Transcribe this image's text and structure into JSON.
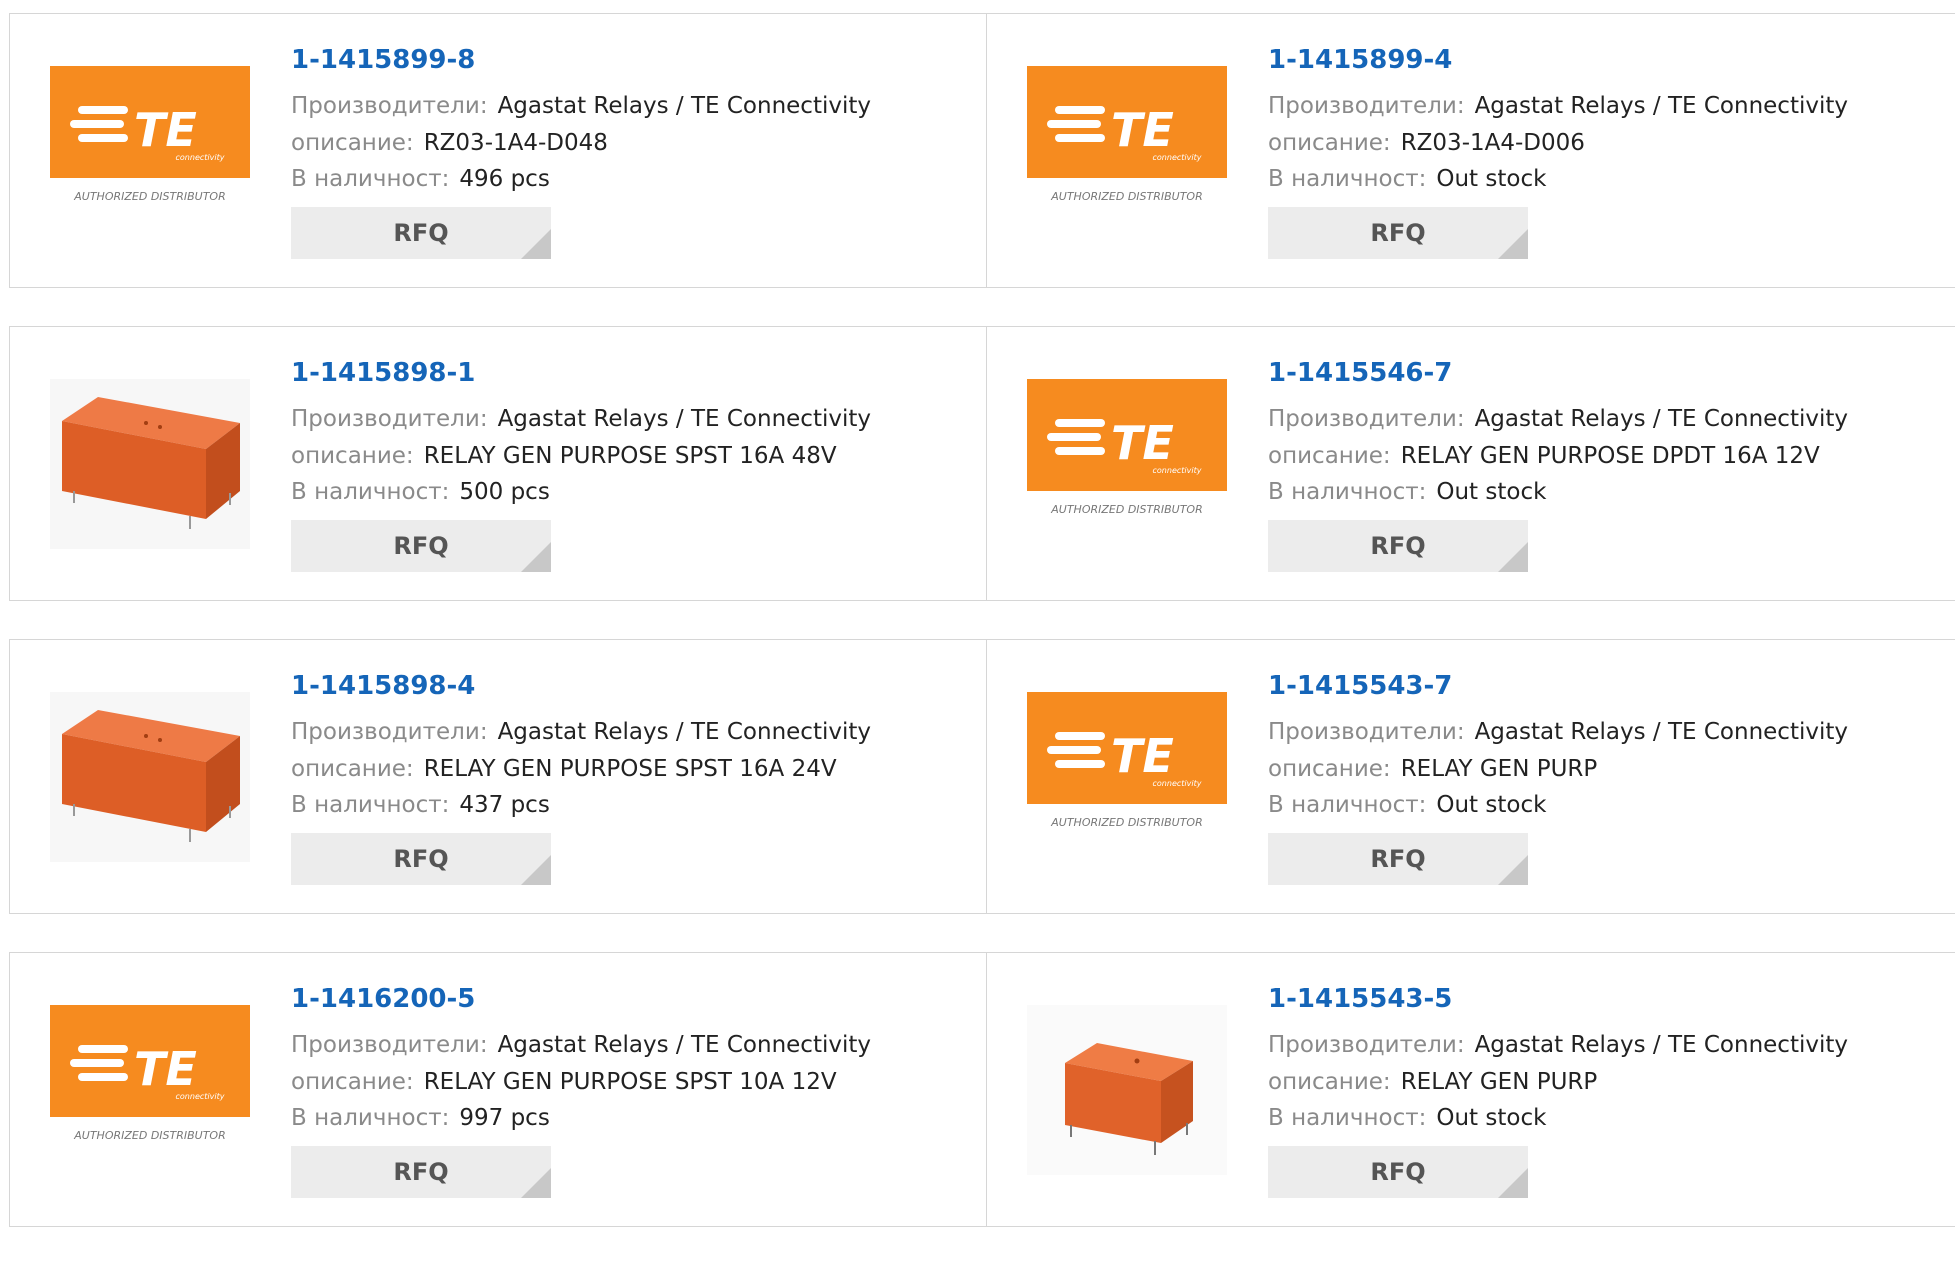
{
  "labels": {
    "manufacturer": "Производители:",
    "description": "описание:",
    "stock": "В наличност:",
    "rfq": "RFQ"
  },
  "logo": {
    "brand": "TE",
    "tagline": "connectivity",
    "badge": "AUTHORIZED DISTRIBUTOR"
  },
  "colors": {
    "part_link": "#1565b8",
    "te_orange": "#f68b1f",
    "relay_orange": "#e0622a",
    "button_bg": "#ececec"
  },
  "products": [
    {
      "part": "1-1415899-8",
      "manufacturer": "Agastat Relays / TE Connectivity",
      "description": "RZ03-1A4-D048",
      "stock": "496 pcs",
      "image": "te-logo"
    },
    {
      "part": "1-1415899-4",
      "manufacturer": "Agastat Relays / TE Connectivity",
      "description": "RZ03-1A4-D006",
      "stock": "Out stock",
      "image": "te-logo"
    },
    {
      "part": "1-1415898-1",
      "manufacturer": "Agastat Relays / TE Connectivity",
      "description": "RELAY GEN PURPOSE SPST 16A 48V",
      "stock": "500 pcs",
      "image": "relay-photo"
    },
    {
      "part": "1-1415546-7",
      "manufacturer": "Agastat Relays / TE Connectivity",
      "description": "RELAY GEN PURPOSE DPDT 16A 12V",
      "stock": "Out stock",
      "image": "te-logo"
    },
    {
      "part": "1-1415898-4",
      "manufacturer": "Agastat Relays / TE Connectivity",
      "description": "RELAY GEN PURPOSE SPST 16A 24V",
      "stock": "437 pcs",
      "image": "relay-photo"
    },
    {
      "part": "1-1415543-7",
      "manufacturer": "Agastat Relays / TE Connectivity",
      "description": "RELAY GEN PURP",
      "stock": "Out stock",
      "image": "te-logo"
    },
    {
      "part": "1-1416200-5",
      "manufacturer": "Agastat Relays / TE Connectivity",
      "description": "RELAY GEN PURPOSE SPST 10A 12V",
      "stock": "997 pcs",
      "image": "te-logo"
    },
    {
      "part": "1-1415543-5",
      "manufacturer": "Agastat Relays / TE Connectivity",
      "description": "RELAY GEN PURP",
      "stock": "Out stock",
      "image": "relay-photo-small"
    }
  ]
}
